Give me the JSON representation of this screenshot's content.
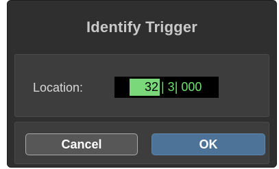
{
  "dialog": {
    "title": "Identify Trigger",
    "location": {
      "label": "Location:",
      "selected_segment": "32",
      "remaining_text": "| 3| 000"
    },
    "buttons": {
      "cancel_label": "Cancel",
      "ok_label": "OK"
    }
  },
  "colors": {
    "dialog_bg": "#2f2f2f",
    "panel_bg": "#3d3d3d",
    "field_bg": "#000000",
    "field_text": "#6fe06f",
    "field_selection": "#7ad77a",
    "ok_button": "#4d7399",
    "cancel_button": "#575757"
  }
}
